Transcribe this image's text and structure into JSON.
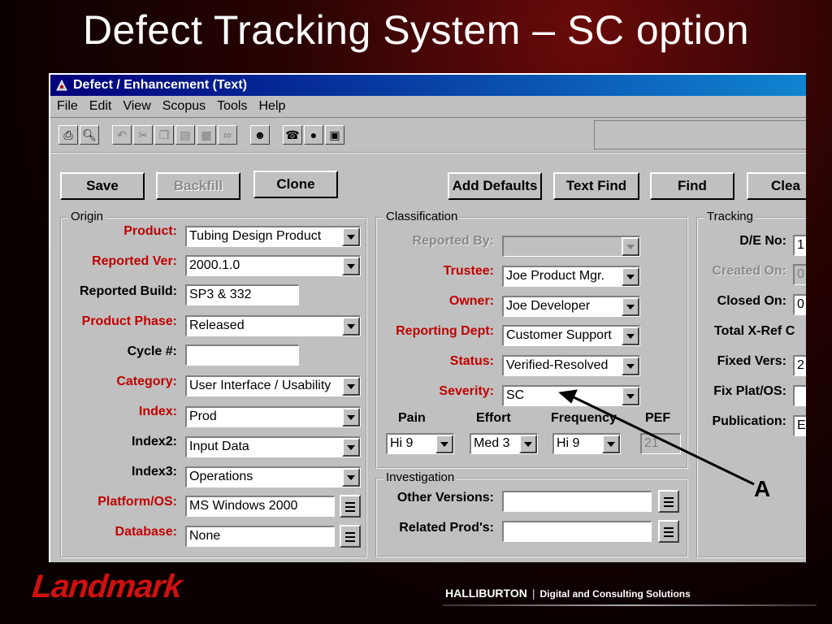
{
  "slide": {
    "title": "Defect Tracking System – SC option",
    "callout_label": "A",
    "footer_logo": "Landmark",
    "footer_company": "HALLIBURTON",
    "footer_separator": "|",
    "footer_tagline": "Digital and Consulting Solutions"
  },
  "window": {
    "title": "Defect / Enhancement (Text)",
    "menu": [
      "File",
      "Edit",
      "View",
      "Scopus",
      "Tools",
      "Help"
    ]
  },
  "toolbar_icons": [
    "print-icon",
    "print-preview-icon",
    "undo-icon",
    "cut-icon",
    "copy-icon",
    "paste-icon",
    "find-icon",
    "binoculars-icon",
    "user-icon",
    "phone-icon",
    "globe-icon",
    "note-icon"
  ],
  "buttons": {
    "save": "Save",
    "backfill": "Backfill",
    "clone": "Clone",
    "add_defaults": "Add Defaults",
    "text_find": "Text Find",
    "find": "Find",
    "clear": "Clea"
  },
  "origin": {
    "legend": "Origin",
    "product_label": "Product:",
    "product_value": "Tubing Design Product",
    "reported_ver_label": "Reported Ver:",
    "reported_ver_value": "2000.1.0",
    "reported_build_label": "Reported Build:",
    "reported_build_value": "SP3 & 332",
    "product_phase_label": "Product Phase:",
    "product_phase_value": "Released",
    "cycle_label": "Cycle #:",
    "cycle_value": "",
    "category_label": "Category:",
    "category_value": "User Interface / Usability",
    "index_label": "Index:",
    "index_value": "Prod",
    "index2_label": "Index2:",
    "index2_value": "Input Data",
    "index3_label": "Index3:",
    "index3_value": "Operations",
    "platform_label": "Platform/OS:",
    "platform_value": "MS Windows 2000",
    "database_label": "Database:",
    "database_value": "None"
  },
  "classification": {
    "legend": "Classification",
    "reported_by_label": "Reported By:",
    "reported_by_value": "",
    "trustee_label": "Trustee:",
    "trustee_value": "Joe Product Mgr.",
    "owner_label": "Owner:",
    "owner_value": "Joe Developer",
    "reporting_dept_label": "Reporting Dept:",
    "reporting_dept_value": "Customer Support",
    "status_label": "Status:",
    "status_value": "Verified-Resolved",
    "severity_label": "Severity:",
    "severity_value": "SC",
    "pain_label": "Pain",
    "pain_value": "Hi 9",
    "effort_label": "Effort",
    "effort_value": "Med 3",
    "frequency_label": "Frequency",
    "frequency_value": "Hi 9",
    "pef_label": "PEF",
    "pef_value": "21"
  },
  "investigation": {
    "legend": "Investigation",
    "other_versions_label": "Other Versions:",
    "other_versions_value": "",
    "related_prods_label": "Related Prod's:",
    "related_prods_value": ""
  },
  "tracking": {
    "legend": "Tracking",
    "de_no_label": "D/E No:",
    "de_no_value": "1",
    "created_on_label": "Created On:",
    "created_on_value": "0",
    "closed_on_label": "Closed On:",
    "closed_on_value": "0",
    "total_xref_label": "Total X-Ref C",
    "fixed_vers_label": "Fixed Vers:",
    "fixed_vers_value": "2",
    "fix_plat_label": "Fix Plat/OS:",
    "fix_plat_value": "",
    "publication_label": "Publication:",
    "publication_value": "E"
  }
}
